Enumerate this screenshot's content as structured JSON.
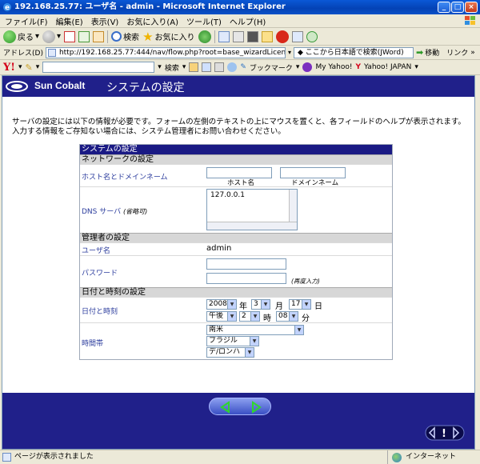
{
  "window": {
    "title": "192.168.25.77: ユーザ名 - admin - Microsoft Internet Explorer"
  },
  "menu": [
    "ファイル(F)",
    "編集(E)",
    "表示(V)",
    "お気に入り(A)",
    "ツール(T)",
    "ヘルプ(H)"
  ],
  "toolbar": {
    "back": "戻る",
    "search": "検索",
    "favorites": "お気に入り"
  },
  "address": {
    "label": "アドレス(D)",
    "url": "http://192.168.25.77:444/nav/flow.php?root=base_wizardLicense",
    "search_text": "ここから日本語で検索(JWord)",
    "go": "移動",
    "links": "リンク"
  },
  "yahoo_bar": {
    "logo": "Y!",
    "search": "検索",
    "bookmark": "ブックマーク",
    "myyahoo": "My Yahoo!",
    "yahoojapan": "Yahoo! JAPAN"
  },
  "header": {
    "logo": "Sun Cobalt",
    "title": "システムの設定"
  },
  "intro": "サーバの設定には以下の情報が必要です。フォームの左側のテキストの上にマウスを置くと、各フィールドのヘルプが表示されます。入力する情報をご存知ない場合には、システム管理者にお問い合わせください。",
  "form": {
    "title": "システムの設定",
    "network": {
      "section": "ネットワークの設定",
      "host_label": "ホスト名とドメインネーム",
      "host_caption": "ホスト名",
      "domain_caption": "ドメインネーム",
      "dns_label": "DNS サーバ",
      "dns_optional": "(省略可)",
      "dns_value": "127.0.0.1"
    },
    "admin": {
      "section": "管理者の設定",
      "user_label": "ユーザ名",
      "user_value": "admin",
      "password_label": "パスワード",
      "reenter": "(再度入力)"
    },
    "datetime": {
      "section": "日付と時刻の設定",
      "label": "日付と時刻",
      "year": "2008",
      "year_unit": "年",
      "month": "3",
      "month_unit": "月",
      "day": "17",
      "day_unit": "日",
      "ampm": "午後",
      "hour": "2",
      "hour_unit": "時",
      "minute": "08",
      "minute_unit": "分",
      "tz_label": "時間帯",
      "tz_region": "南米",
      "tz_country": "ブラジル",
      "tz_city": "デ/ロンハ"
    }
  },
  "status": {
    "text": "ページが表示されました",
    "zone": "インターネット"
  }
}
